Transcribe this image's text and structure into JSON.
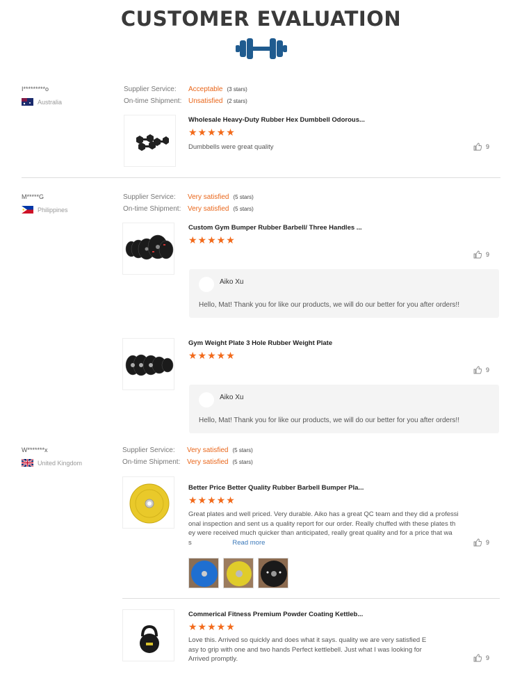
{
  "header": {
    "title": "CUSTOMER EVALUATION",
    "icon": "dumbbell-icon",
    "accent": "#1f5b8f"
  },
  "labels": {
    "supplier_service": "Supplier Service:",
    "ontime_shipment": "On-time Shipment:",
    "read_more": "Read more"
  },
  "reviews": [
    {
      "name": "I*********o",
      "country": "Australia",
      "supplier_service": {
        "value": "Acceptable",
        "stars": "(3 stars)"
      },
      "ontime_shipment": {
        "value": "Unsatisfied",
        "stars": "(2 stars)"
      },
      "products": [
        {
          "name": "Wholesale Heavy-Duty Rubber Hex Dumbbell Odorous...",
          "stars": "★★★★★",
          "comment": "Dumbbells were great quality",
          "likes": "9"
        }
      ]
    },
    {
      "name": "M*****G",
      "country": "Philippines",
      "supplier_service": {
        "value": "Very satisfied",
        "stars": "(5 stars)"
      },
      "ontime_shipment": {
        "value": "Very satisfied",
        "stars": "(5 stars)"
      },
      "products": [
        {
          "name": "Custom Gym Bumper Rubber Barbell/ Three Handles ...",
          "stars": "★★★★★",
          "likes": "9",
          "reply": {
            "name": "Aiko Xu",
            "text": "Hello, Mat! Thank you for like our products, we will do our better for you after orders!!"
          }
        },
        {
          "name": "Gym Weight Plate 3 Hole Rubber Weight Plate",
          "stars": "★★★★★",
          "likes": "9",
          "reply": {
            "name": "Aiko Xu",
            "text": "Hello, Mat! Thank you for like our products, we will do our better for you after orders!!"
          }
        }
      ]
    },
    {
      "name": "W*******x",
      "country": "United Kingdom",
      "supplier_service": {
        "value": "Very satisfied",
        "stars": "(5 stars)"
      },
      "ontime_shipment": {
        "value": "Very satisfied",
        "stars": "(5 stars)"
      },
      "products": [
        {
          "name": "Better Price Better Quality Rubber Barbell Bumper Pla...",
          "stars": "★★★★★",
          "likes": "9",
          "comment_lines": [
            "Great plates and well priced. Very durable. Aiko has a great QC team and they did a professi",
            "onal inspection and sent us a quality report for our order. Really chuffed with these plates th",
            "ey were received much quicker than anticipated, really great quality and for a price that wa",
            "s"
          ]
        },
        {
          "name": "Commerical Fitness Premium Powder Coating Kettleb...",
          "stars": "★★★★★",
          "likes": "9",
          "comment_lines": [
            "Love this. Arrived so quickly and does what it says. quality we are very satisfied E",
            "asy to grip with one and two hands Perfect kettlebell. Just what I was looking for",
            "Arrived promptly."
          ]
        }
      ]
    }
  ]
}
